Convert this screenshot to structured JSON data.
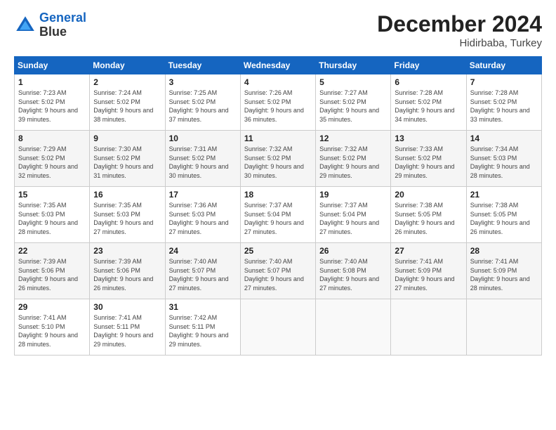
{
  "header": {
    "logo_line1": "General",
    "logo_line2": "Blue",
    "month": "December 2024",
    "location": "Hidirbaba, Turkey"
  },
  "weekdays": [
    "Sunday",
    "Monday",
    "Tuesday",
    "Wednesday",
    "Thursday",
    "Friday",
    "Saturday"
  ],
  "weeks": [
    [
      {
        "day": "1",
        "sunrise": "7:23 AM",
        "sunset": "5:02 PM",
        "daylight": "9 hours and 39 minutes."
      },
      {
        "day": "2",
        "sunrise": "7:24 AM",
        "sunset": "5:02 PM",
        "daylight": "9 hours and 38 minutes."
      },
      {
        "day": "3",
        "sunrise": "7:25 AM",
        "sunset": "5:02 PM",
        "daylight": "9 hours and 37 minutes."
      },
      {
        "day": "4",
        "sunrise": "7:26 AM",
        "sunset": "5:02 PM",
        "daylight": "9 hours and 36 minutes."
      },
      {
        "day": "5",
        "sunrise": "7:27 AM",
        "sunset": "5:02 PM",
        "daylight": "9 hours and 35 minutes."
      },
      {
        "day": "6",
        "sunrise": "7:28 AM",
        "sunset": "5:02 PM",
        "daylight": "9 hours and 34 minutes."
      },
      {
        "day": "7",
        "sunrise": "7:28 AM",
        "sunset": "5:02 PM",
        "daylight": "9 hours and 33 minutes."
      }
    ],
    [
      {
        "day": "8",
        "sunrise": "7:29 AM",
        "sunset": "5:02 PM",
        "daylight": "9 hours and 32 minutes."
      },
      {
        "day": "9",
        "sunrise": "7:30 AM",
        "sunset": "5:02 PM",
        "daylight": "9 hours and 31 minutes."
      },
      {
        "day": "10",
        "sunrise": "7:31 AM",
        "sunset": "5:02 PM",
        "daylight": "9 hours and 30 minutes."
      },
      {
        "day": "11",
        "sunrise": "7:32 AM",
        "sunset": "5:02 PM",
        "daylight": "9 hours and 30 minutes."
      },
      {
        "day": "12",
        "sunrise": "7:32 AM",
        "sunset": "5:02 PM",
        "daylight": "9 hours and 29 minutes."
      },
      {
        "day": "13",
        "sunrise": "7:33 AM",
        "sunset": "5:02 PM",
        "daylight": "9 hours and 29 minutes."
      },
      {
        "day": "14",
        "sunrise": "7:34 AM",
        "sunset": "5:03 PM",
        "daylight": "9 hours and 28 minutes."
      }
    ],
    [
      {
        "day": "15",
        "sunrise": "7:35 AM",
        "sunset": "5:03 PM",
        "daylight": "9 hours and 28 minutes."
      },
      {
        "day": "16",
        "sunrise": "7:35 AM",
        "sunset": "5:03 PM",
        "daylight": "9 hours and 27 minutes."
      },
      {
        "day": "17",
        "sunrise": "7:36 AM",
        "sunset": "5:03 PM",
        "daylight": "9 hours and 27 minutes."
      },
      {
        "day": "18",
        "sunrise": "7:37 AM",
        "sunset": "5:04 PM",
        "daylight": "9 hours and 27 minutes."
      },
      {
        "day": "19",
        "sunrise": "7:37 AM",
        "sunset": "5:04 PM",
        "daylight": "9 hours and 27 minutes."
      },
      {
        "day": "20",
        "sunrise": "7:38 AM",
        "sunset": "5:05 PM",
        "daylight": "9 hours and 26 minutes."
      },
      {
        "day": "21",
        "sunrise": "7:38 AM",
        "sunset": "5:05 PM",
        "daylight": "9 hours and 26 minutes."
      }
    ],
    [
      {
        "day": "22",
        "sunrise": "7:39 AM",
        "sunset": "5:06 PM",
        "daylight": "9 hours and 26 minutes."
      },
      {
        "day": "23",
        "sunrise": "7:39 AM",
        "sunset": "5:06 PM",
        "daylight": "9 hours and 26 minutes."
      },
      {
        "day": "24",
        "sunrise": "7:40 AM",
        "sunset": "5:07 PM",
        "daylight": "9 hours and 27 minutes."
      },
      {
        "day": "25",
        "sunrise": "7:40 AM",
        "sunset": "5:07 PM",
        "daylight": "9 hours and 27 minutes."
      },
      {
        "day": "26",
        "sunrise": "7:40 AM",
        "sunset": "5:08 PM",
        "daylight": "9 hours and 27 minutes."
      },
      {
        "day": "27",
        "sunrise": "7:41 AM",
        "sunset": "5:09 PM",
        "daylight": "9 hours and 27 minutes."
      },
      {
        "day": "28",
        "sunrise": "7:41 AM",
        "sunset": "5:09 PM",
        "daylight": "9 hours and 28 minutes."
      }
    ],
    [
      {
        "day": "29",
        "sunrise": "7:41 AM",
        "sunset": "5:10 PM",
        "daylight": "9 hours and 28 minutes."
      },
      {
        "day": "30",
        "sunrise": "7:41 AM",
        "sunset": "5:11 PM",
        "daylight": "9 hours and 29 minutes."
      },
      {
        "day": "31",
        "sunrise": "7:42 AM",
        "sunset": "5:11 PM",
        "daylight": "9 hours and 29 minutes."
      },
      null,
      null,
      null,
      null
    ]
  ]
}
